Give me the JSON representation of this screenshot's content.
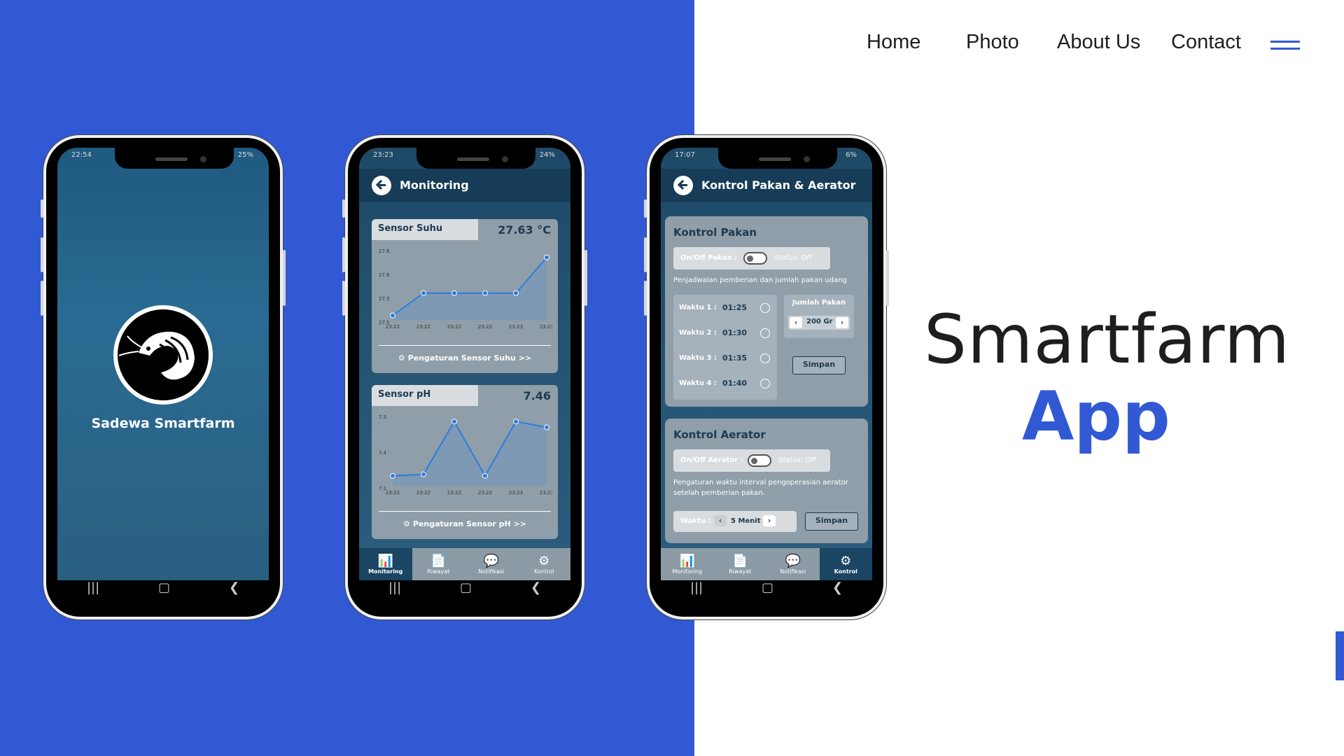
{
  "nav": {
    "home": "Home",
    "photo": "Photo",
    "about": "About Us",
    "contact": "Contact"
  },
  "hero": {
    "line1": "Smartfarm",
    "line2": "App"
  },
  "colors": {
    "brand_blue": "#3159d3",
    "app_dark": "#163c58",
    "card_gray": "#8f9ea8"
  },
  "phone1": {
    "status_time": "22:54",
    "status_right": "25%",
    "brand": "Sadewa Smartfarm",
    "logo_icon": "shrimp-icon"
  },
  "phone2": {
    "status_time": "23:23",
    "status_right": "24%",
    "title": "Monitoring",
    "suhu": {
      "label": "Sensor Suhu",
      "value": "27.63 °C",
      "link": "Pengaturan Sensor Suhu >>",
      "yticks": [
        "27.6",
        "27.6",
        "27.5",
        "27.5"
      ],
      "xticks": [
        "23:22",
        "23:22",
        "23:22",
        "23:22",
        "23:23",
        "23:23"
      ],
      "chart_data": {
        "type": "line",
        "x": [
          "23:22",
          "23:22",
          "23:22",
          "23:22",
          "23:23",
          "23:23"
        ],
        "values": [
          27.5,
          27.55,
          27.55,
          27.55,
          27.55,
          27.63
        ],
        "ylim": [
          27.49,
          27.65
        ]
      }
    },
    "ph": {
      "label": "Sensor pH",
      "value": "7.46",
      "link": "Pengaturan Sensor pH >>",
      "yticks": [
        "7.3",
        "7.4",
        "7.1"
      ],
      "xticks": [
        "23:22",
        "23:22",
        "23:22",
        "23:22",
        "23:23",
        "23:23"
      ],
      "chart_data": {
        "type": "line",
        "x": [
          "23:22",
          "23:22",
          "23:22",
          "23:22",
          "23:23",
          "23:23"
        ],
        "values": [
          7.12,
          7.13,
          7.5,
          7.12,
          7.5,
          7.46
        ],
        "ylim": [
          7.05,
          7.55
        ]
      }
    },
    "tabs": [
      {
        "label": "Monitoring",
        "icon": "bar-chart-icon",
        "active": true
      },
      {
        "label": "Riwayat",
        "icon": "history-icon",
        "active": false
      },
      {
        "label": "Notifikasi",
        "icon": "chat-icon",
        "active": false
      },
      {
        "label": "Kontrol",
        "icon": "gears-icon",
        "active": false
      }
    ]
  },
  "phone3": {
    "status_time": "17:07",
    "status_right": "6%",
    "title": "Kontrol Pakan & Aerator",
    "pakan": {
      "title": "Kontrol Pakan",
      "toggle_label": "On/Off Pakan :",
      "status": "Status: Off",
      "desc": "Penjadwalan pemberian dan jumlah pakan udang",
      "times": [
        {
          "label": "Waktu 1 :",
          "value": "01:25"
        },
        {
          "label": "Waktu 2 :",
          "value": "01:30"
        },
        {
          "label": "Waktu 3 :",
          "value": "01:35"
        },
        {
          "label": "Waktu 4 :",
          "value": "01:40"
        }
      ],
      "jumlah_label": "Jumlah Pakan",
      "jumlah_value": "200 Gr",
      "save": "Simpan"
    },
    "aerator": {
      "title": "Kontrol Aerator",
      "toggle_label": "On/Off Aerator :",
      "status": "Status: Off",
      "desc": "Pengaturan waktu interval pengoperasian aerator setelah pemberian pakan.",
      "waktu_label": "Waktu :",
      "waktu_value": "5 Menit",
      "save": "Simpan"
    },
    "tabs": [
      {
        "label": "Monitoring",
        "icon": "bar-chart-icon",
        "active": false
      },
      {
        "label": "Riwayat",
        "icon": "history-icon",
        "active": false
      },
      {
        "label": "Notifikasi",
        "icon": "chat-icon",
        "active": false
      },
      {
        "label": "Kontrol",
        "icon": "gears-icon",
        "active": true
      }
    ]
  }
}
